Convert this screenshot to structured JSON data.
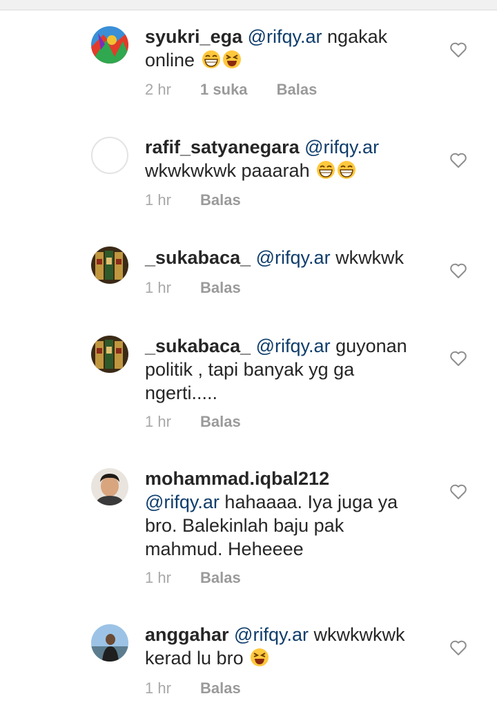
{
  "comments": [
    {
      "username": "syukri_ega",
      "mention": "@rifqy.ar",
      "text": " ngakak online",
      "emojis": [
        "grin-emoji",
        "laugh-emoji"
      ],
      "time": "2 hr",
      "likes": "1 suka",
      "reply": "Balas"
    },
    {
      "username": "rafif_satyanegara",
      "mention": "@rifqy.ar",
      "text": " wkwkwkwk paaarah",
      "emojis": [
        "grin-emoji",
        "grin-emoji"
      ],
      "time": "1 hr",
      "likes": "",
      "reply": "Balas"
    },
    {
      "username": "_sukabaca_",
      "mention": "@rifqy.ar",
      "text": " wkwkwk",
      "emojis": [],
      "time": "1 hr",
      "likes": "",
      "reply": "Balas"
    },
    {
      "username": "_sukabaca_",
      "mention": "@rifqy.ar",
      "text": " guyonan politik , tapi banyak yg ga ngerti.....",
      "emojis": [],
      "time": "1 hr",
      "likes": "",
      "reply": "Balas"
    },
    {
      "username": "mohammad.iqbal212",
      "mention": "@rifqy.ar",
      "text": " hahaaaa. Iya juga ya bro. Balekinlah baju pak mahmud. Heheeee",
      "emojis": [],
      "time": "1 hr",
      "likes": "",
      "reply": "Balas"
    },
    {
      "username": "anggahar",
      "mention": "@rifqy.ar",
      "text": " wkwkwkwk kerad lu bro",
      "emojis": [
        "laugh-emoji"
      ],
      "time": "1 hr",
      "likes": "",
      "reply": "Balas"
    }
  ],
  "colors": {
    "mention": "#0f3d6b",
    "meta": "#a8a8a8",
    "text": "#262626"
  }
}
